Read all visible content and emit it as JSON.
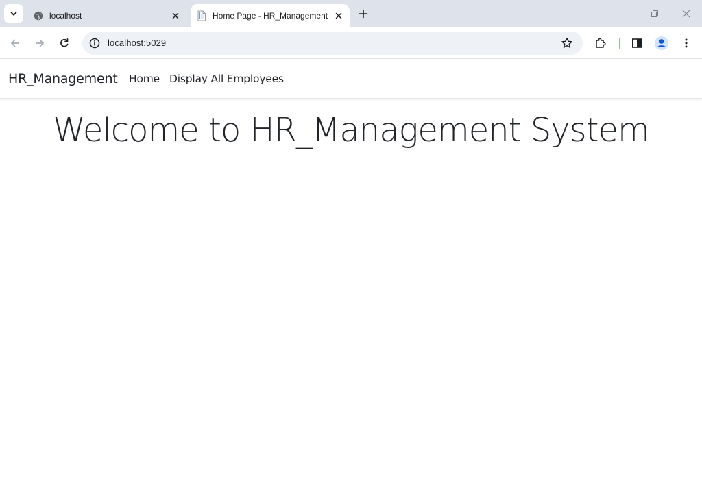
{
  "browser": {
    "tabs": [
      {
        "title": "localhost",
        "icon": "globe-icon",
        "active": false
      },
      {
        "title": "Home Page - HR_Management",
        "icon": "document-icon",
        "active": true
      }
    ],
    "url": "localhost:5029"
  },
  "app": {
    "brand": "HR_Management",
    "nav": [
      {
        "label": "Home"
      },
      {
        "label": "Display All Employees"
      }
    ],
    "heading": "Welcome to HR_Management System"
  },
  "colors": {
    "tabstrip_bg": "#dee3eb",
    "omnibox_bg": "#eef1f6",
    "text": "#212529",
    "profile_accent": "#0b57d0"
  }
}
